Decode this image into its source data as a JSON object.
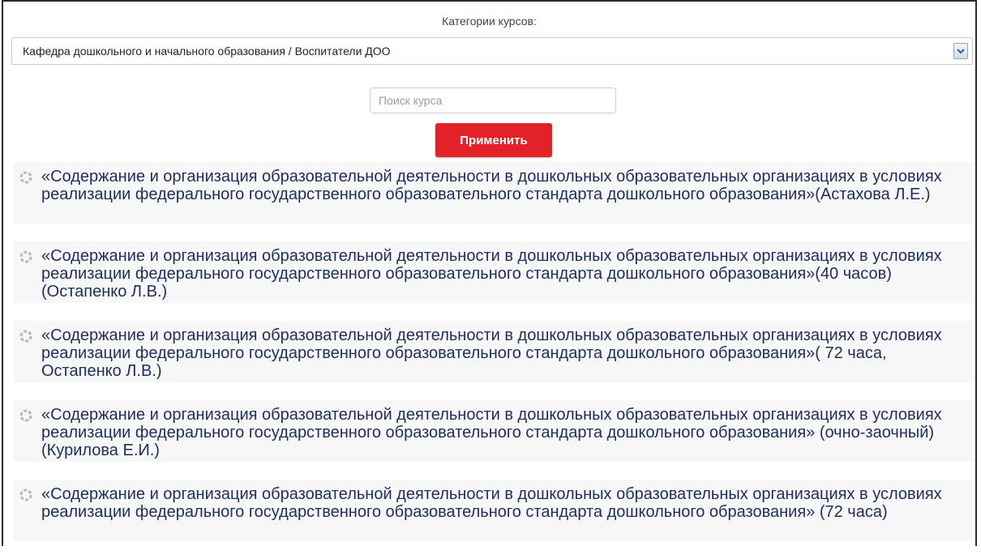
{
  "filter": {
    "category_label": "Категории курсов:",
    "selected_category": "Кафедра дошкольного и начального образования / Воспитатели ДОО",
    "search_placeholder": "Поиск курса",
    "apply_label": "Применить"
  },
  "courses": [
    {
      "title": "«Содержание и организация образовательной деятельности в дошкольных образовательных организациях в условиях реализации федерального государственного образовательного стандарта дошкольного образования»(Астахова Л.Е.)",
      "icon": "course-icon"
    },
    {
      "title": "«Содержание и организация образовательной деятельности в дошкольных образовательных организациях в условиях реализации федерального государственного образовательного стандарта дошкольного образования»(40 часов)(Остапенко Л.В.)",
      "icon": "course-icon"
    },
    {
      "title": "«Содержание и организация образовательной деятельности в дошкольных образовательных организациях в условиях реализации федерального государственного образовательного стандарта дошкольного образования»( 72 часа, Остапенко Л.В.)",
      "icon": "course-icon"
    },
    {
      "title": "«Содержание и организация образовательной деятельности в дошкольных образовательных организациях в условиях реализации федерального государственного образовательного стандарта дошкольного образования» (очно-заочный) (Курилова Е.И.)",
      "icon": "course-icon"
    },
    {
      "title": "«Содержание и организация образовательной деятельности в дошкольных образовательных организациях в условиях реализации федерального государственного образовательного стандарта дошкольного образования» (72 часа)",
      "icon": "course-icon"
    }
  ],
  "colors": {
    "accent_button": "#e32129",
    "link": "#1e2e5c",
    "item_bg": "#f7f7f7"
  }
}
